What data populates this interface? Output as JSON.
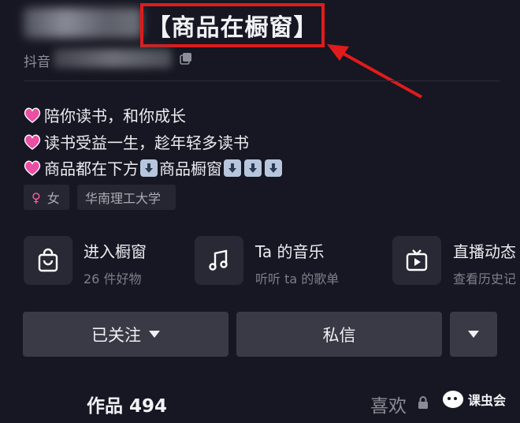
{
  "header": {
    "highlight_text": "【商品在橱窗】",
    "platform_label": "抖音"
  },
  "bio": {
    "line1": "陪你读书，和你成长",
    "line2": "读书受益一生，趁年轻多读书",
    "line3_a": "商品都在下方",
    "line3_b": "商品橱窗"
  },
  "tags": {
    "gender_symbol": "♀",
    "gender": "女",
    "school": "华南理工大学"
  },
  "entries": [
    {
      "title": "进入橱窗",
      "subtitle": "26 件好物",
      "icon": "shopping-bag-icon"
    },
    {
      "title": "Ta 的音乐",
      "subtitle": "听听 ta 的歌单",
      "icon": "music-note-icon"
    },
    {
      "title": "直播动态",
      "subtitle": "查看历史记",
      "icon": "tv-icon"
    }
  ],
  "buttons": {
    "followed": "已关注",
    "message": "私信"
  },
  "tabs": {
    "works": "作品 494",
    "likes": "喜欢"
  },
  "watermark": "课虫会",
  "colors": {
    "background": "#161722",
    "highlight_border": "#e01b1b",
    "button": "#393a45",
    "heart": "#e94fa3",
    "gender": "#ff5fa8"
  }
}
